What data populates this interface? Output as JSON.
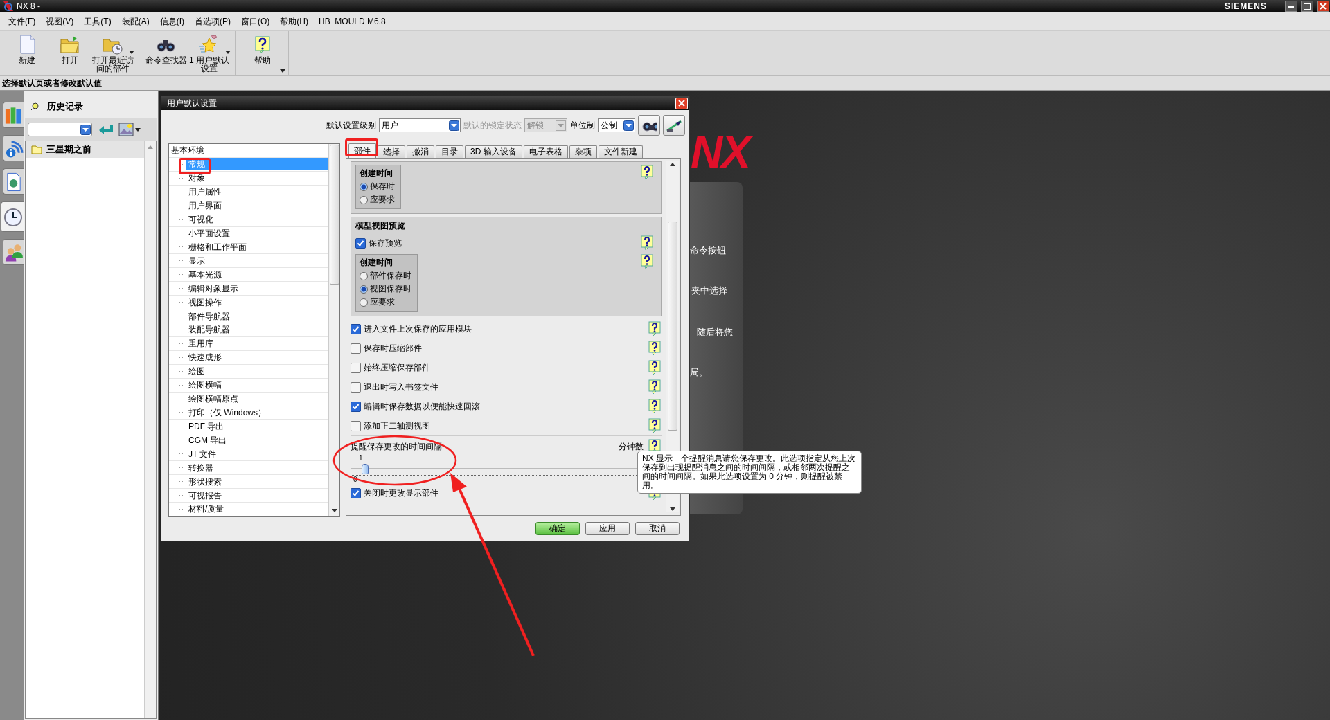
{
  "window": {
    "title": "NX 8 -",
    "brand": "SIEMENS"
  },
  "menu": [
    "文件(F)",
    "视图(V)",
    "工具(T)",
    "装配(A)",
    "信息(I)",
    "首选项(P)",
    "窗口(O)",
    "帮助(H)",
    "HB_MOULD M6.8"
  ],
  "toolbar": [
    {
      "items": [
        {
          "kind": "new",
          "label": "新建",
          "dropdown": false
        },
        {
          "kind": "open",
          "label": "打开",
          "dropdown": false
        },
        {
          "kind": "recent",
          "label": "打开最近访问的部件",
          "dropdown": true
        }
      ]
    },
    {
      "items": [
        {
          "kind": "finder",
          "label": "命令查找器",
          "dropdown": false
        },
        {
          "kind": "defaults",
          "label": "1 用户默认设置",
          "dropdown": true
        }
      ]
    },
    {
      "items": [
        {
          "kind": "help",
          "label": "帮助",
          "dropdown": false
        }
      ]
    }
  ],
  "prompt": "选择默认页或者修改默认值",
  "side_tabs": [
    {
      "kind": "books",
      "selected": false
    },
    {
      "kind": "info",
      "selected": false
    },
    {
      "kind": "document",
      "selected": false
    },
    {
      "kind": "clock",
      "selected": true
    },
    {
      "kind": "people",
      "selected": false
    }
  ],
  "history": {
    "title": "历史记录",
    "groups": [
      "三星期之前"
    ]
  },
  "background": {
    "logo": "NX",
    "fragments": [
      "命令按钮",
      "夹中选择",
      "随后将您",
      "局。"
    ]
  },
  "dialog": {
    "title": "用户默认设置",
    "level_label": "默认设置级别",
    "level_value": "用户",
    "lock_label": "默认的锁定状态",
    "lock_value": "解锁",
    "lock_disabled": true,
    "unit_label": "单位制",
    "unit_value": "公制",
    "tree": {
      "label": "基本环境",
      "children": [
        {
          "label": "常规",
          "selected": true
        },
        {
          "label": "对象",
          "selected": false
        },
        {
          "label": "用户属性",
          "selected": false
        },
        {
          "label": "用户界面",
          "selected": false
        },
        {
          "label": "可视化",
          "selected": false
        },
        {
          "label": "小平面设置",
          "selected": false
        },
        {
          "label": "栅格和工作平面",
          "selected": false
        },
        {
          "label": "显示",
          "selected": false
        },
        {
          "label": "基本光源",
          "selected": false
        },
        {
          "label": "编辑对象显示",
          "selected": false
        },
        {
          "label": "视图操作",
          "selected": false
        },
        {
          "label": "部件导航器",
          "selected": false
        },
        {
          "label": "装配导航器",
          "selected": false
        },
        {
          "label": "重用库",
          "selected": false
        },
        {
          "label": "快速成形",
          "selected": false
        },
        {
          "label": "绘图",
          "selected": false
        },
        {
          "label": "绘图横幅",
          "selected": false
        },
        {
          "label": "绘图横幅原点",
          "selected": false
        },
        {
          "label": "打印（仅 Windows）",
          "selected": false
        },
        {
          "label": "PDF 导出",
          "selected": false
        },
        {
          "label": "CGM 导出",
          "selected": false
        },
        {
          "label": "JT 文件",
          "selected": false
        },
        {
          "label": "转换器",
          "selected": false
        },
        {
          "label": "形状搜索",
          "selected": false
        },
        {
          "label": "可视报告",
          "selected": false
        },
        {
          "label": "材料/质量",
          "selected": false
        }
      ]
    },
    "tabs": [
      {
        "label": "部件",
        "selected": true
      },
      {
        "label": "选择",
        "selected": false
      },
      {
        "label": "撤消",
        "selected": false
      },
      {
        "label": "目录",
        "selected": false
      },
      {
        "label": "3D 输入设备",
        "selected": false
      },
      {
        "label": "电子表格",
        "selected": false
      },
      {
        "label": "杂项",
        "selected": false
      },
      {
        "label": "文件新建",
        "selected": false
      }
    ],
    "sections": [
      {
        "kind": "panel",
        "items": [
          {
            "kind": "radio_group",
            "title": "创建时间",
            "options": [
              {
                "label": "保存时",
                "selected": true
              },
              {
                "label": "应要求",
                "selected": false
              }
            ]
          }
        ]
      },
      {
        "kind": "panel",
        "heading": "模型视图预览",
        "items": [
          {
            "kind": "checkbox",
            "label": "保存预览",
            "checked": true
          },
          {
            "kind": "radio_group",
            "title": "创建时间",
            "options": [
              {
                "label": "部件保存时",
                "selected": false
              },
              {
                "label": "视图保存时",
                "selected": true
              },
              {
                "label": "应要求",
                "selected": false
              }
            ]
          }
        ]
      },
      {
        "kind": "checkbox",
        "label": "进入文件上次保存的应用模块",
        "checked": true
      },
      {
        "kind": "checkbox",
        "label": "保存时压缩部件",
        "checked": false
      },
      {
        "kind": "checkbox",
        "label": "始终压缩保存部件",
        "checked": false
      },
      {
        "kind": "checkbox",
        "label": "退出时写入书签文件",
        "checked": false
      },
      {
        "kind": "checkbox",
        "label": "编辑时保存数据以便能快速回滚",
        "checked": true
      },
      {
        "kind": "checkbox",
        "label": "添加正二轴测视图",
        "checked": false
      },
      {
        "kind": "slider",
        "label": "提醒保存更改的时间间隔",
        "unit": "分钟数",
        "value_label": "1",
        "min_label": "0",
        "level": 0.02
      },
      {
        "kind": "checkbox",
        "label": "关闭时更改显示部件",
        "checked": true
      }
    ],
    "buttons": [
      {
        "label": "确定",
        "default": true
      },
      {
        "label": "应用",
        "default": false
      },
      {
        "label": "取消",
        "default": false
      }
    ]
  },
  "tooltip": "NX 显示一个提醒消息请您保存更改。此选项指定从您上次保存到出现提醒消息之间的时间间隔，或相邻两次提醒之间的时间间隔。如果此选项设置为 0 分钟，则提醒被禁用。"
}
